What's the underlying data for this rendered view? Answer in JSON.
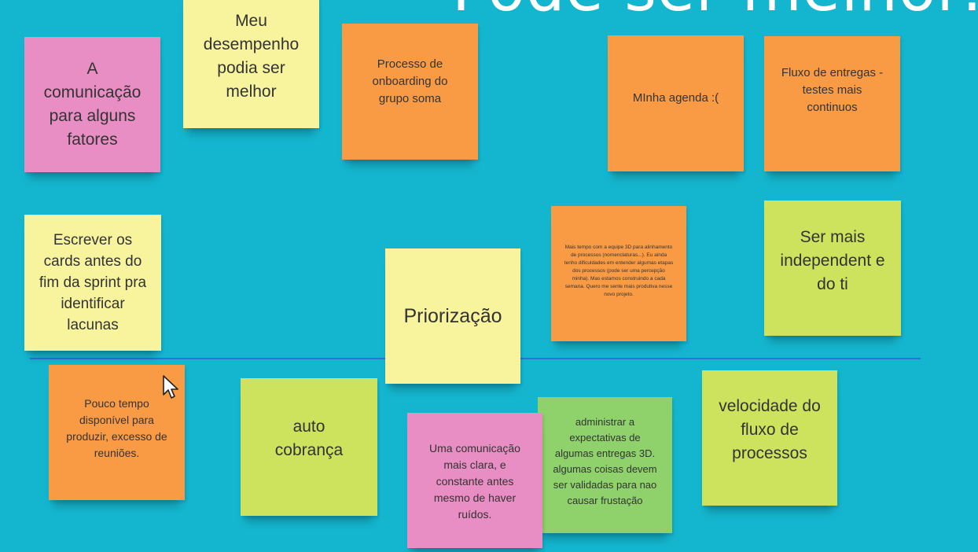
{
  "board": {
    "title": "Pode ser melhor:",
    "background": "#14b6cf",
    "divider_color": "#2f6fd8"
  },
  "notes": [
    {
      "text": "A comunicação para alguns fatores",
      "color": "#e98ec4"
    },
    {
      "text": "Meu desempenho podia ser melhor",
      "color": "#f8f49e"
    },
    {
      "text": "Processo de onboarding do grupo soma",
      "color": "#f99b45"
    },
    {
      "text": "MInha agenda :(",
      "color": "#f99b45"
    },
    {
      "text": "Fluxo de entregas - testes mais continuos",
      "color": "#f99b45"
    },
    {
      "text": "Escrever os cards antes do fim da sprint pra identificar lacunas",
      "color": "#f8f49e"
    },
    {
      "text": "Priorização",
      "color": "#f8f49e"
    },
    {
      "text": "Mais tempo com a equipe 3D para alinhamento de processos (nomenclaturas...). Eu ainda tenho dificuldades em entender algumas etapas dos processos (pode ser uma percepção minha). Mas estamos construindo a cada semana. Quero me sente mais produtiva nesse novo projeto.",
      "color": "#f99b45"
    },
    {
      "text": "Ser mais independent e do ti",
      "color": "#cde35d"
    },
    {
      "text": "Pouco tempo disponível para produzir, excesso de reuniões.",
      "color": "#f99b45"
    },
    {
      "text": "auto cobrança",
      "color": "#cde35d"
    },
    {
      "text": "Uma comunicação mais clara, e constante antes mesmo de haver ruídos.",
      "color": "#e98ec4"
    },
    {
      "text": "administrar a expectativas de algumas entregas 3D. algumas coisas devem ser validadas para nao causar frustação",
      "color": "#8fd26c"
    },
    {
      "text": "velocidade do fluxo de processos",
      "color": "#cde35d"
    }
  ]
}
